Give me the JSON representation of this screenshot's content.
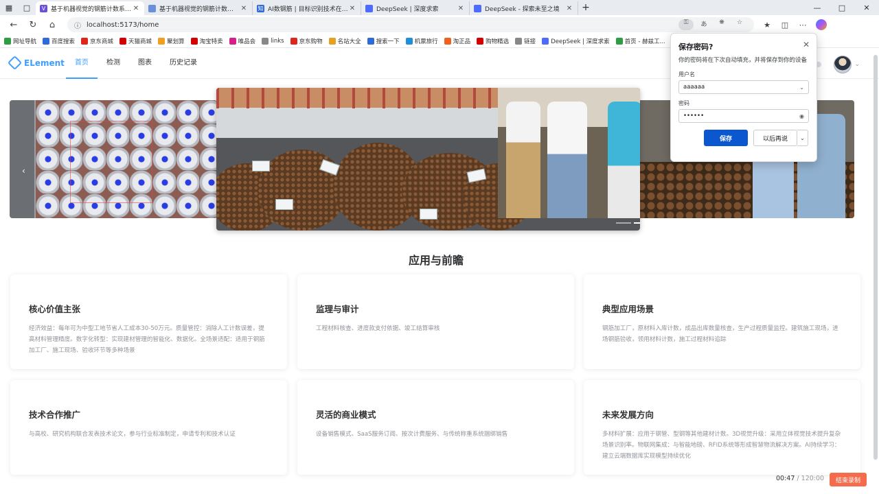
{
  "browser": {
    "tabs": [
      {
        "label": "基于机器视觉的钢筋计数系统算法...",
        "active": true,
        "favicon_color": "#6b4fd8",
        "favicon": "V"
      },
      {
        "label": "基于机器视觉的钢筋计数系统算法...",
        "active": false,
        "favicon_color": "#6b8fd8",
        "favicon": ""
      },
      {
        "label": "AI数钢筋 | 目标识别技术在钢筋计...",
        "active": false,
        "favicon_color": "#2f6bd8",
        "favicon": "知"
      },
      {
        "label": "DeepSeek | 深度求索",
        "active": false,
        "favicon_color": "#4d6bfe",
        "favicon": ""
      },
      {
        "label": "DeepSeek - 探索未至之境",
        "active": false,
        "favicon_color": "#4d6bfe",
        "favicon": ""
      }
    ],
    "new_tab": "+",
    "url": "localhost:5173/home",
    "bookmarks": [
      {
        "label": "网址导航",
        "color": "#2e9e44"
      },
      {
        "label": "百度搜索",
        "color": "#2f6bd8"
      },
      {
        "label": "京东商城",
        "color": "#e1251b"
      },
      {
        "label": "天猫商城",
        "color": "#d40000"
      },
      {
        "label": "聚划算",
        "color": "#f0a020"
      },
      {
        "label": "淘宝特卖",
        "color": "#d40000"
      },
      {
        "label": "唯品会",
        "color": "#d61f8a"
      },
      {
        "label": "links",
        "color": "#888888"
      },
      {
        "label": "京东购物",
        "color": "#e1251b"
      },
      {
        "label": "名站大全",
        "color": "#e8a020"
      },
      {
        "label": "搜索一下",
        "color": "#2f6bd8"
      },
      {
        "label": "机票旅行",
        "color": "#1f8fd8"
      },
      {
        "label": "淘正品",
        "color": "#f06020"
      },
      {
        "label": "购物精选",
        "color": "#d40000"
      },
      {
        "label": "链接",
        "color": "#888888"
      },
      {
        "label": "DeepSeek | 深度求索",
        "color": "#4d6bfe"
      },
      {
        "label": "首页 - 赫兹工...",
        "color": "#2e9e44"
      }
    ]
  },
  "app": {
    "logo": "ELement",
    "menu": [
      "首页",
      "检测",
      "图表",
      "历史记录"
    ],
    "section_title": "应用与前瞻",
    "cards": [
      {
        "title": "核心价值主张",
        "desc": "经济效益：每年可为中型工地节省人工成本30-50万元。质量管控：消除人工计数误差，提高材料管理精度。数字化转型：实现建材管理的智能化、数据化。全场景适配：适用于钢筋加工厂、施工现场、验收环节等多种场景"
      },
      {
        "title": "监理与审计",
        "desc": "工程材料核查、进度款支付依据、竣工结算审核"
      },
      {
        "title": "典型应用场景",
        "desc": "钢筋加工厂，原材料入库计数，成品出库数量核查，生产过程质量监控。建筑施工现场，进场钢筋验收，领用材料计数，施工过程材料追踪"
      },
      {
        "title": "技术合作推广",
        "desc": "与高校、研究机构联合发表技术论文，参与行业标准制定，申请专利和技术认证"
      },
      {
        "title": "灵活的商业模式",
        "desc": "设备销售模式、SaaS服务订阅、按次计费服务、与传统称重系统捆绑销售"
      },
      {
        "title": "未来发展方向",
        "desc": "多材料扩展：应用于钢管、型钢等其他建材计数。3D视觉升级：采用立体视觉技术提升复杂场景识别率。物联网集成：与智能地磅、RFID系统等形成智慧物流解决方案。AI持续学习：建立云端数据库实现模型持续优化"
      }
    ]
  },
  "password_popup": {
    "title": "保存密码?",
    "desc": "你的密码将在下次自动填充，并将保存到你的设备",
    "username_label": "用户名",
    "username_value": "aaaaaa",
    "password_label": "密码",
    "password_value": "••••••",
    "save": "保存",
    "later": "以后再说"
  },
  "recorder": {
    "elapsed": "00:47",
    "total": "120:00",
    "stop": "结束录制"
  },
  "colors": {
    "accent": "#409eff",
    "save_button": "#0b57d0",
    "stop_button": "#f56c4c"
  }
}
